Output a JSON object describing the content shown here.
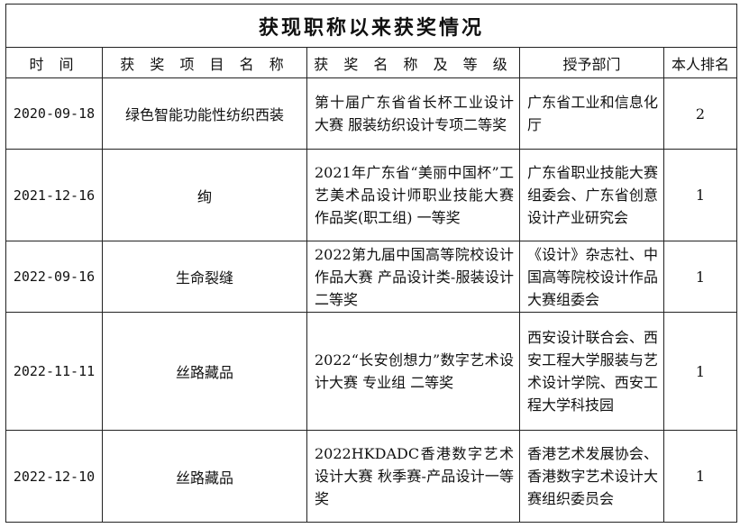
{
  "title": "获现职称以来获奖情况",
  "headers": {
    "date": "时  间",
    "project": "获 奖 项 目 名 称",
    "award": "获 奖 名 称 及 等 级",
    "department": "授予部门",
    "rank": "本人排名"
  },
  "rows": [
    {
      "date": "2020-09-18",
      "project": "绿色智能功能性纺织西装",
      "award": "第十届广东省省长杯工业设计大赛  服装纺织设计专项二等奖",
      "department": "广东省工业和信息化厅",
      "rank": "2"
    },
    {
      "date": "2021-12-16",
      "project": "绚",
      "award": "2021年广东省“美丽中国杯”工艺美术品设计师职业技能大赛 作品奖(职工组)   一等奖",
      "department": "广东省职业技能大赛组委会、广东省创意设计产业研究会",
      "rank": "1"
    },
    {
      "date": "2022-09-16",
      "project": "生命裂缝",
      "award": "2022第九届中国高等院校设计作品大赛 产品设计类-服装设计   二等奖",
      "department": "《设计》杂志社、中国高等院校设计作品大赛组委会",
      "rank": "1"
    },
    {
      "date": "2022-11-11",
      "project": "丝路藏品",
      "award": "2022“长安创想力”数字艺术设计大赛 专业组   二等奖",
      "department": "西安设计联合会、西安工程大学服装与艺术设计学院、西安工程大学科技园",
      "rank": "1"
    },
    {
      "date": "2022-12-10",
      "project": "丝路藏品",
      "award": "2022HKDADC香港数字艺术设计大赛  秋季赛-产品设计一等奖",
      "department": "香港艺术发展协会、香港数字艺术设计大赛组织委员会",
      "rank": "1"
    }
  ]
}
